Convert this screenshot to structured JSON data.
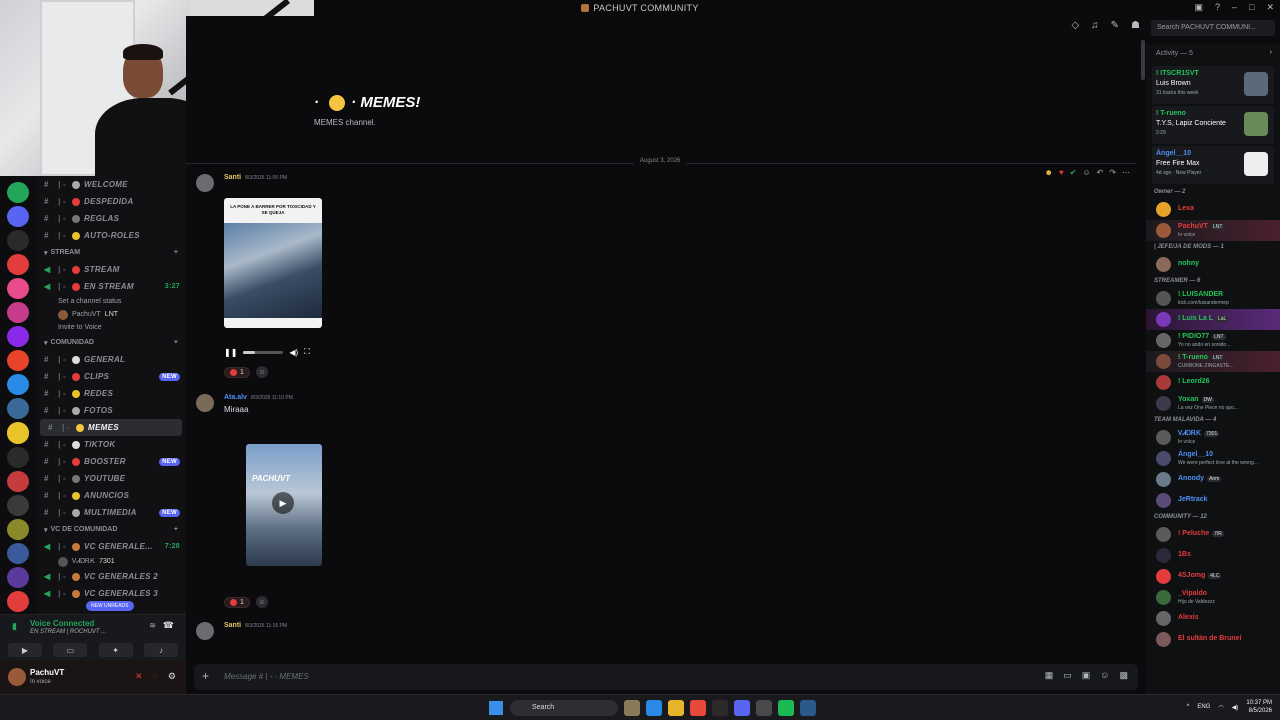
{
  "window": {
    "title": "PACHUVT COMMUNITY"
  },
  "search": {
    "placeholder": "Search PACHUVT COMMUNI..."
  },
  "channels": {
    "top_items": [
      {
        "name": "WELCOME"
      },
      {
        "name": "DESPEDIDA"
      },
      {
        "name": "REGLAS"
      },
      {
        "name": "AUTO-ROLES"
      }
    ],
    "stream_category": "STREAM",
    "stream_items": [
      {
        "name": "STREAM"
      },
      {
        "name": "EN STREAM",
        "time": "3:27"
      }
    ],
    "stream_sub": {
      "status": "Set a channel status",
      "user": "PachuVT",
      "tag": "LNT",
      "invite": "Invite to Voice"
    },
    "comunidad_category": "COMUNIDAD",
    "comunidad_items": [
      {
        "name": "GENERAL",
        "badge": ""
      },
      {
        "name": "CLIPS",
        "badge": "NEW"
      },
      {
        "name": "REDES",
        "badge": ""
      },
      {
        "name": "FOTOS",
        "badge": ""
      },
      {
        "name": "MEMES",
        "badge": ""
      },
      {
        "name": "TIKTOK",
        "badge": ""
      },
      {
        "name": "BOOSTER",
        "badge": "NEW"
      },
      {
        "name": "YOUTUBE",
        "badge": ""
      },
      {
        "name": "ANUNCIOS",
        "badge": ""
      },
      {
        "name": "MULTIMEDIA",
        "badge": "NEW"
      }
    ],
    "vc_category": "VC DE COMUNIDAD",
    "vc_items": [
      {
        "name": "VC GENERALE...",
        "time": "7:28"
      },
      {
        "name": "VC GENERALES 2"
      },
      {
        "name": "VC GENERALES 3"
      }
    ],
    "vc_user": {
      "name": "ᏙᏗᎠᎡᏦ",
      "tag": "7301"
    }
  },
  "voice": {
    "title": "Voice Connected",
    "subtitle": "EN STREAM | ROCHUVT ...",
    "new_unreads": "NEW UNREADS"
  },
  "user": {
    "name": "PachuVT",
    "status": "In voice"
  },
  "main": {
    "channel_title": "MEMES!",
    "welcome_sub": "MEMES channel.",
    "date_divider": "August 3, 2026",
    "composer_placeholder": "Message # | - · MEMES",
    "messages": [
      {
        "author": "Santi",
        "time": "8/3/2026 11:06 PM",
        "author_color": "#e9c46a",
        "video_caption": "LA PONE A BARRER POR TOXICIDAD Y SE QUEJA",
        "reaction_count": "1"
      },
      {
        "author": "Ata.alv",
        "time": "8/3/2026 11:10 PM",
        "author_color": "#4f8ff7",
        "text": "Miraaa",
        "video_label": "PACHUVT",
        "reaction_count": "1"
      },
      {
        "author": "Santi",
        "time": "8/3/2026 11:16 PM",
        "author_color": "#e9c46a"
      }
    ]
  },
  "activity": {
    "header": "Activity — 5",
    "items": [
      {
        "line1": "! ITSCR1SVT",
        "line2": "Luis Brown",
        "line3": "31 tracks this week"
      },
      {
        "line1": "! T-rueno",
        "line2": "T.Y.S, Lapiz Conciente",
        "line3": "2:29"
      },
      {
        "line1": "Ángel__10",
        "line2": "Free Fire Max",
        "line3": "4d ago · New Player"
      }
    ]
  },
  "members": {
    "groups": [
      {
        "label": "Owner — 2",
        "members": [
          {
            "name": "Lexa",
            "tag": "",
            "status": "",
            "color": "#e23c3c",
            "hl": ""
          },
          {
            "name": "PachuVT",
            "tag": "LNT",
            "status": "In voice",
            "color": "#e23c3c",
            "hl": "hl2"
          }
        ]
      },
      {
        "label": "| JEFE/JA DE MODS — 1",
        "members": [
          {
            "name": "nohny",
            "tag": "",
            "status": "",
            "color": "#23c55a",
            "hl": ""
          }
        ]
      },
      {
        "label": "STREAMER — 6",
        "members": [
          {
            "name": "! LUISANDER",
            "tag": "",
            "status": "kick.com/luisandermep",
            "color": "#23c55a",
            "hl": ""
          },
          {
            "name": "! Luis La L",
            "tag": "LaL",
            "status": "",
            "color": "#23c55a",
            "hl": "hl"
          },
          {
            "name": "! PIDIO77",
            "tag": "LNT",
            "status": "Yo no ando en sonido...",
            "color": "#23c55a",
            "hl": ""
          },
          {
            "name": "! T-rueno",
            "tag": "LNT",
            "status": "CURBONE ZINGASTE...",
            "color": "#23c55a",
            "hl": "hl2"
          },
          {
            "name": "! Leord26",
            "tag": "",
            "status": "",
            "color": "#23c55a",
            "hl": ""
          },
          {
            "name": "Yoxan",
            "tag": "DW",
            "status": "La vez One Piece no spo...",
            "color": "#23c55a",
            "hl": ""
          }
        ]
      },
      {
        "label": "TEAM MALAVIDA — 4",
        "members": [
          {
            "name": "ᏙᏗᎠᎡᏦ",
            "tag": "7301",
            "status": "In voice",
            "color": "#4f8ff7",
            "hl": ""
          },
          {
            "name": "Ángel__10",
            "tag": "",
            "status": "We were perfect love at the wrong...",
            "color": "#4f8ff7",
            "hl": ""
          },
          {
            "name": "Anoody",
            "tag": "Anm",
            "status": "",
            "color": "#4f8ff7",
            "hl": ""
          },
          {
            "name": "JeRtrack",
            "tag": "",
            "status": "",
            "color": "#4f8ff7",
            "hl": ""
          }
        ]
      },
      {
        "label": "COMMUNITY — 12",
        "members": [
          {
            "name": "! Peluche",
            "tag": "7IR",
            "status": "",
            "color": "#e23c3c",
            "hl": ""
          },
          {
            "name": "1Bs",
            "tag": "",
            "status": "",
            "color": "#e23c3c",
            "hl": ""
          },
          {
            "name": "4SJomg",
            "tag": "4LC",
            "status": "",
            "color": "#e23c3c",
            "hl": ""
          },
          {
            "name": "_Vipaldo",
            "tag": "",
            "status": "Hijo de Valdezzz",
            "color": "#e23c3c",
            "hl": ""
          },
          {
            "name": "Alexis",
            "tag": "",
            "status": "",
            "color": "#e23c3c",
            "hl": ""
          },
          {
            "name": "El sultán de Bruneí",
            "tag": "",
            "status": "",
            "color": "#e23c3c",
            "hl": ""
          }
        ]
      }
    ]
  },
  "taskbar": {
    "search_label": "Search",
    "lang": "ENG",
    "time": "10:37 PM",
    "date": "8/5/2026"
  }
}
